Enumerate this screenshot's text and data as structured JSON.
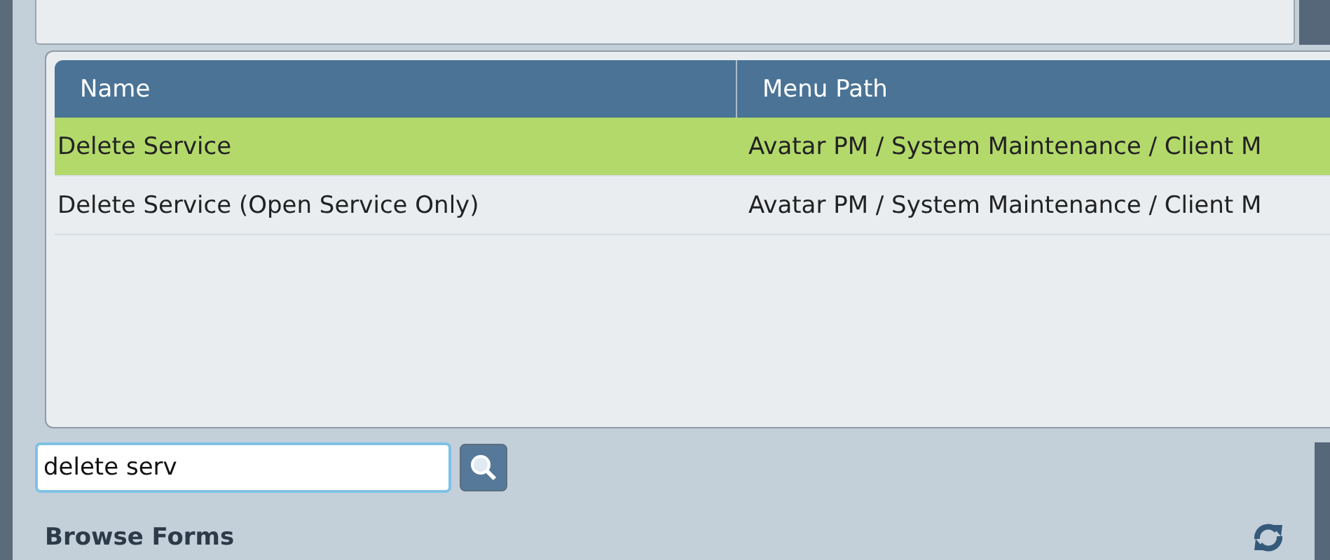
{
  "table": {
    "columns": [
      "Name",
      "Menu Path"
    ],
    "rows": [
      {
        "name": "Delete Service",
        "menu_path": "Avatar PM / System Maintenance / Client M",
        "selected": true
      },
      {
        "name": "Delete Service (Open Service Only)",
        "menu_path": "Avatar PM / System Maintenance / Client M",
        "selected": false
      }
    ]
  },
  "search": {
    "value": "delete serv"
  },
  "section": {
    "title": "Browse Forms"
  }
}
